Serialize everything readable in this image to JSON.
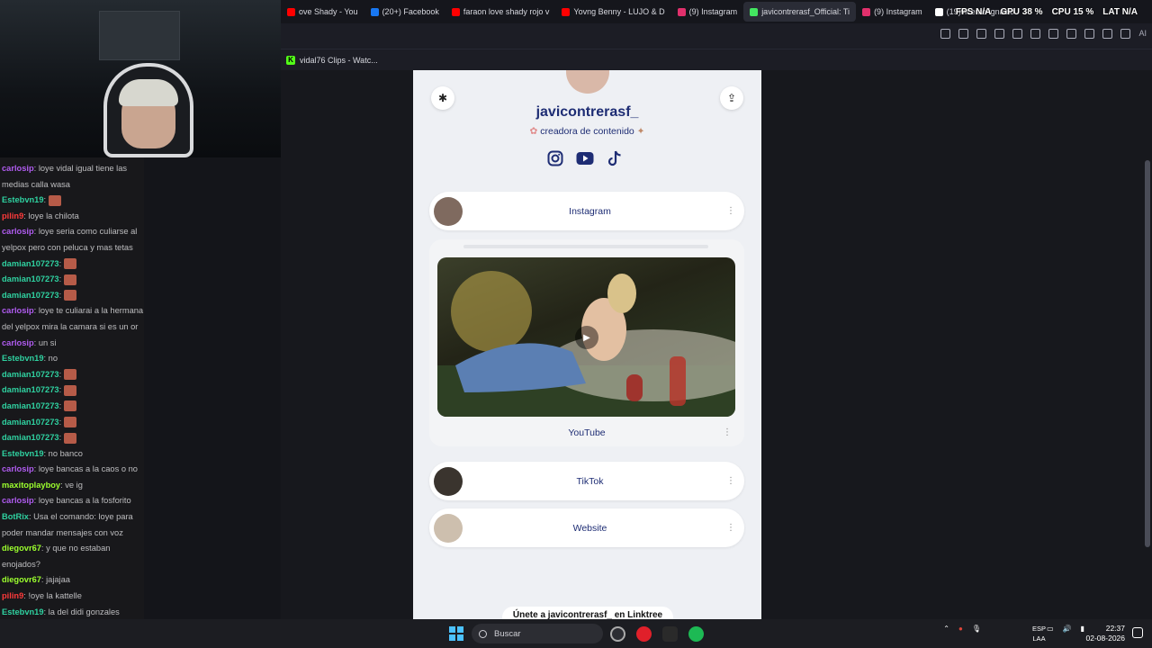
{
  "tabs": [
    {
      "label": "ove Shady - You",
      "color": "#ff0000",
      "active": false
    },
    {
      "label": "(20+) Facebook",
      "color": "#1877f2",
      "active": false
    },
    {
      "label": "faraon love shady rojo v",
      "color": "#ff0000",
      "active": false
    },
    {
      "label": "Yovng Benny - LUJO & D",
      "color": "#ff0000",
      "active": false
    },
    {
      "label": "(9) Instagram",
      "color": "#e1306c",
      "active": false
    },
    {
      "label": "javicontrerasf_Official: Ti",
      "color": "#43e660",
      "active": true
    },
    {
      "label": "(9) Instagram",
      "color": "#e1306c",
      "active": false
    },
    {
      "label": "(19)vicente ignacio",
      "color": "#ffffff",
      "active": false
    }
  ],
  "overlay": {
    "fps_label": "FPS",
    "fps": "N/A",
    "gpu_label": "GPU",
    "gpu": "38",
    "cpu_label": "CPU",
    "cpu": "15",
    "lat_label": "LAT",
    "lat": "N/A"
  },
  "toolbar": {
    "ai_label": "AI"
  },
  "bookmark": {
    "label": "vidal76 Clips - Watc..."
  },
  "chat": [
    {
      "user": "carlosip",
      "color": "#b05cf0",
      "text": ": loye vidal igual tiene las medias calla wasa"
    },
    {
      "user": "Estebvn19",
      "color": "#2fd1a0",
      "text": ":",
      "emote": true
    },
    {
      "user": "pilin9",
      "color": "#ff3a3a",
      "text": ": loye la chilota"
    },
    {
      "user": "carlosip",
      "color": "#b05cf0",
      "text": ": loye seria como culiarse al yelpox pero con peluca y mas tetas"
    },
    {
      "user": "damian107273",
      "color": "#2fd1a0",
      "text": ":",
      "emote": true
    },
    {
      "user": "damian107273",
      "color": "#2fd1a0",
      "text": ":",
      "emote": true
    },
    {
      "user": "damian107273",
      "color": "#2fd1a0",
      "text": ":",
      "emote": true
    },
    {
      "user": "carlosip",
      "color": "#b05cf0",
      "text": ": loye te culiarai a la hermana del yelpox mira la camara si es un or"
    },
    {
      "user": "carlosip",
      "color": "#b05cf0",
      "text": ": un si"
    },
    {
      "user": "Estebvn19",
      "color": "#2fd1a0",
      "text": ": no"
    },
    {
      "user": "damian107273",
      "color": "#2fd1a0",
      "text": ":",
      "emote": true
    },
    {
      "user": "damian107273",
      "color": "#2fd1a0",
      "text": ":",
      "emote": true
    },
    {
      "user": "damian107273",
      "color": "#2fd1a0",
      "text": ":",
      "emote": true
    },
    {
      "user": "damian107273",
      "color": "#2fd1a0",
      "text": ":",
      "emote": true
    },
    {
      "user": "damian107273",
      "color": "#2fd1a0",
      "text": ":",
      "emote": true
    },
    {
      "user": "Estebvn19",
      "color": "#2fd1a0",
      "text": ": no banco"
    },
    {
      "user": "carlosip",
      "color": "#b05cf0",
      "text": ": loye bancas a la caos o no"
    },
    {
      "user": "maxitoplayboy",
      "color": "#9cff2e",
      "text": ": ve ig"
    },
    {
      "user": "carlosip",
      "color": "#b05cf0",
      "text": ": loye bancas a la fosforito"
    },
    {
      "user": "BotRix",
      "color": "#2fd1a0",
      "text": ": Usa el comando: loye para poder mandar mensajes con voz"
    },
    {
      "user": "diegovr67",
      "color": "#9cff2e",
      "text": ": y que no estaban enojados?"
    },
    {
      "user": "diegovr67",
      "color": "#9cff2e",
      "text": ": jajajaa"
    },
    {
      "user": "pilin9",
      "color": "#ff3a3a",
      "text": ": !oye la kattelle"
    },
    {
      "user": "Estebvn19",
      "color": "#2fd1a0",
      "text": ": la del didi gonzales"
    }
  ],
  "linktree": {
    "name": "javicontrerasf_",
    "bio": "creadora de contenido",
    "links": [
      {
        "label": "Instagram"
      },
      {
        "label": "YouTube"
      },
      {
        "label": "TikTok"
      },
      {
        "label": "Website"
      }
    ],
    "join_label": "Únete a javicontrerasf_ en Linktree"
  },
  "taskbar": {
    "search_placeholder": "Buscar",
    "lang_top": "ESP",
    "lang_bottom": "LAA",
    "time": "22:37",
    "date": "02-08-2026"
  }
}
